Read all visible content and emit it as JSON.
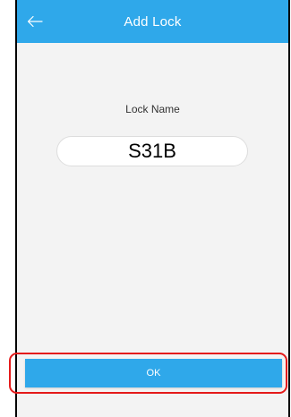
{
  "header": {
    "title": "Add Lock",
    "back_icon": "arrow-left-icon"
  },
  "form": {
    "label": "Lock Name",
    "lock_name_value": "S31B"
  },
  "actions": {
    "ok_label": "OK"
  },
  "colors": {
    "accent": "#2fa8ea",
    "background": "#f3f3f3",
    "highlight": "#e41a1a"
  }
}
